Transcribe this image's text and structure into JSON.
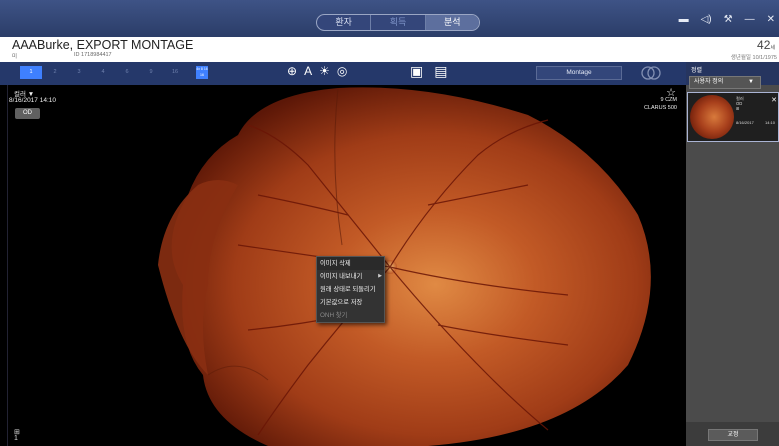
{
  "tabs": [
    {
      "label": "환자"
    },
    {
      "label": "획득"
    },
    {
      "label": "분석"
    }
  ],
  "top_icons": [
    "monitor-icon",
    "speaker-icon",
    "wrench-icon",
    "minimize-icon",
    "close-icon"
  ],
  "patient": {
    "name": "AAABurke, EXPORT MONTAGE",
    "id_label": "미",
    "id": "ID 1718984417",
    "age": "42",
    "age_unit": "세",
    "dob": "생년월일 10/1/1975"
  },
  "toolbar": {
    "layouts": [
      "1",
      "2",
      "3",
      "4",
      "6",
      "9",
      "16"
    ],
    "mini_layout": "4x 8\n16 16",
    "montage_label": "Montage"
  },
  "viewer": {
    "label": "컬러",
    "date": "8/16/2017 14:10",
    "eye": "OD",
    "device_line1": "9 CZM",
    "device_line2": "CLARUS 500",
    "bottom_icon": "⊞\n1"
  },
  "context_menu": [
    {
      "label": "이미지 삭제",
      "disabled": false
    },
    {
      "label": "이미지 내보내기",
      "disabled": false
    },
    {
      "label": "원래 상태로 되돌리기",
      "disabled": false
    },
    {
      "label": "기본값으로 저장",
      "disabled": false
    },
    {
      "label": "ONH 찾기",
      "disabled": true
    }
  ],
  "right_panel": {
    "title": "정렬",
    "select_value": "사용자 정의",
    "thumb": {
      "type": "컬러",
      "eye": "OD",
      "date": "8/16/2017",
      "time": "14:10"
    },
    "footer_button": "교정"
  },
  "colors": {
    "topbar": "#2f416f",
    "toolbar": "#25386a",
    "accent": "#3f80ff",
    "retina_center": "#d87a3c",
    "retina_edge": "#6e1d0a"
  }
}
